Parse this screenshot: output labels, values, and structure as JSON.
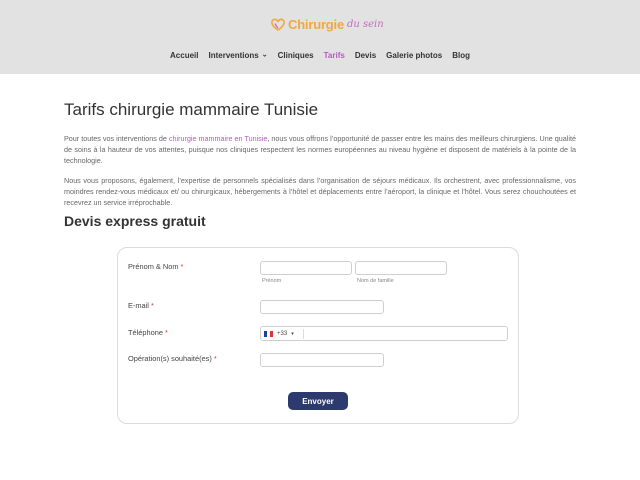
{
  "brand": {
    "name": "Chirurgie",
    "tagline": "du sein",
    "colors": {
      "orange": "#f1a83c",
      "purple": "#b65bbf",
      "navy": "#2d3a6e"
    }
  },
  "nav": {
    "items": [
      {
        "label": "Accueil",
        "active": false
      },
      {
        "label": "Interventions",
        "active": false,
        "has_dropdown": true
      },
      {
        "label": "Cliniques",
        "active": false
      },
      {
        "label": "Tarifs",
        "active": true
      },
      {
        "label": "Devis",
        "active": false
      },
      {
        "label": "Galerie photos",
        "active": false
      },
      {
        "label": "Blog",
        "active": false
      }
    ]
  },
  "content": {
    "title": "Tarifs chirurgie mammaire Tunisie",
    "p1_before": "Pour toutes vos interventions de ",
    "p1_link": "chirurgie mammaire en Tunisie",
    "p1_after": ", nous vous offrons l’opportunité de passer entre les mains des meilleurs chirurgiens. Une qualité de soins à la hauteur de vos attentes, puisque nos cliniques respectent les normes européennes au niveau hygiène et disposent de matériels à la pointe de la technologie.",
    "p2": "Nous vous proposons, également, l’expertise de personnels spécialisés dans l’organisation de séjours médicaux. Ils orchestrent, avec professionnalisme, vos moindres rendez-vous médicaux et/ ou chirurgicaux, hébergements à l’hôtel et déplacements entre l’aéroport, la clinique et l’hôtel. Vous serez chouchoutées et recevrez un service irréprochable.",
    "subtitle": "Devis express gratuit"
  },
  "form": {
    "name_label": "Prénom & Nom",
    "required_mark": "*",
    "first_name_hint": "Prénom",
    "last_name_hint": "Nom de famille",
    "email_label": "E-mail",
    "phone_label": "Téléphone",
    "phone_dial_code": "+33",
    "phone_country_icon": "france-flag-icon",
    "operations_label": "Opération(s) souhaité(es)",
    "submit_label": "Envoyer",
    "first_name_value": "",
    "last_name_value": "",
    "email_value": "",
    "phone_value": "",
    "operations_value": ""
  }
}
